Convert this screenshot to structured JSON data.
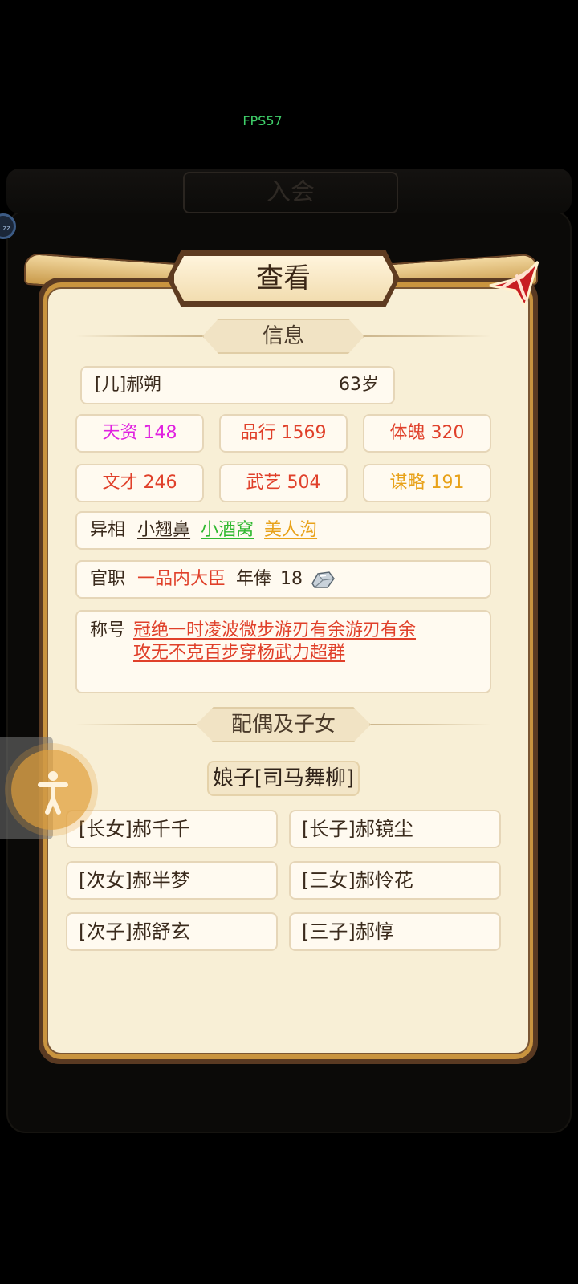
{
  "fps": "FPS57",
  "background_title": "入会",
  "background_badge": "zz",
  "dialog": {
    "title": "查看",
    "section_info": "信息",
    "section_family": "配偶及子女"
  },
  "person": {
    "name": "[儿]郝朔",
    "age": "63岁"
  },
  "stats": [
    {
      "label": "天资 148",
      "color": "#e020e0"
    },
    {
      "label": "品行 1569",
      "color": "#e0402a"
    },
    {
      "label": "体魄 320",
      "color": "#e0402a"
    },
    {
      "label": "文才 246",
      "color": "#e0402a"
    },
    {
      "label": "武艺 504",
      "color": "#e0402a"
    },
    {
      "label": "谋略 191",
      "color": "#e8a21a"
    }
  ],
  "features": {
    "label": "异相",
    "items": [
      {
        "text": "小翘鼻",
        "color": "#3a2a1c"
      },
      {
        "text": "小酒窝",
        "color": "#2fb82f"
      },
      {
        "text": "美人沟",
        "color": "#e8a21a"
      }
    ]
  },
  "official": {
    "label": "官职",
    "title": "一品内大臣",
    "salary_label": "年俸",
    "salary": "18",
    "salary_icon": "silver-ingot-icon"
  },
  "honors": {
    "label": "称号",
    "line1": "冠绝一时凌波微步游刃有余游刃有余",
    "line2": "攻无不克百步穿杨武力超群"
  },
  "spouse": "娘子[司马舞柳]",
  "children": [
    "[长女]郝千千",
    "[长子]郝镜尘",
    "[次女]郝半梦",
    "[三女]郝怜花",
    "[次子]郝舒玄",
    "[三子]郝惇"
  ]
}
